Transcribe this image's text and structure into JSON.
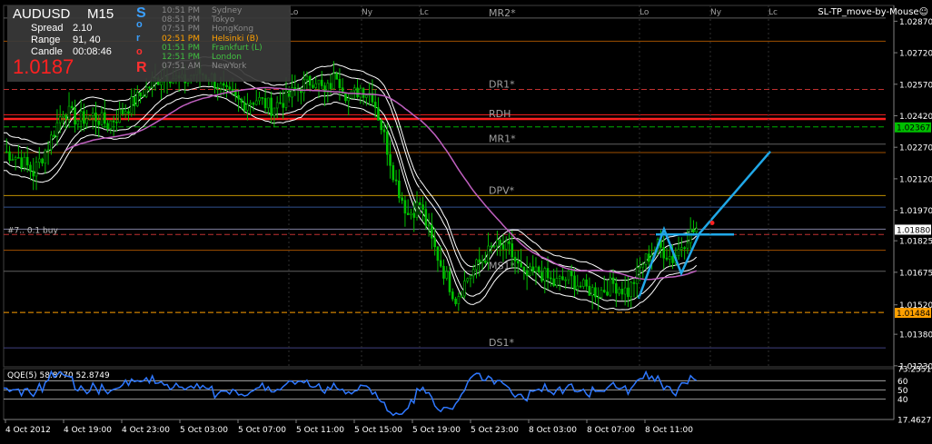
{
  "colors": {
    "background": "#000000",
    "candle_bull": "#00c000",
    "candle_bear": "#00c000",
    "envelope": "#ffffff",
    "ma": "#c060c0",
    "zigzag": "#20a8e8",
    "qqe_line": "#2f78ff",
    "grid": "#555555",
    "text": "#ffffff",
    "price_label_bg": "#ffffff",
    "green_level": "#00c000",
    "orange_level": "#ffa000",
    "red_level": "#ff2020"
  },
  "info": {
    "symbol": "AUDUSD",
    "timeframe": "M15",
    "spread_label": "Spread",
    "spread_value": "2.10",
    "range_label": "Range",
    "range_value": "91, 40",
    "candle_label": "Candle",
    "candle_value": "00:08:46",
    "price": "1.0187"
  },
  "vertical_letters": [
    {
      "ch": "S",
      "color": "#3aa0ff"
    },
    {
      "ch": "o",
      "color": "#3aa0ff"
    },
    {
      "ch": "r",
      "color": "#3aa0ff"
    },
    {
      "ch": "o",
      "color": "#ff3030"
    },
    {
      "ch": "R",
      "color": "#ff3030"
    }
  ],
  "sessions": [
    {
      "time": "10:51 PM",
      "city": "Sydney",
      "color": "#888888"
    },
    {
      "time": "08:51 PM",
      "city": "Tokyo",
      "color": "#888888"
    },
    {
      "time": "07:51 PM",
      "city": "HongKong",
      "color": "#888888"
    },
    {
      "time": "02:51 PM",
      "city": "Helsinki  (B)",
      "color": "#ffa000"
    },
    {
      "time": "01:51 PM",
      "city": "Frankfurt  (L)",
      "color": "#40c040"
    },
    {
      "time": "12:51 PM",
      "city": "London",
      "color": "#40c040"
    },
    {
      "time": "07:51 AM",
      "city": "NewYork",
      "color": "#888888"
    }
  ],
  "ea_label": "SL-TP_move-by-Mouse☺",
  "session_markers": [
    {
      "label": "Lo",
      "x": 318
    },
    {
      "label": "Ny",
      "x": 398
    },
    {
      "label": "Lc",
      "x": 462
    },
    {
      "label": "Lo",
      "x": 704
    },
    {
      "label": "Ny",
      "x": 782
    },
    {
      "label": "Lc",
      "x": 846
    }
  ],
  "chart_data": [
    {
      "type": "candlestick",
      "title": "AUDUSD M15",
      "ylim": [
        1.01225,
        1.02945
      ],
      "y_ticks": [
        "1.02870",
        "1.02720",
        "1.02570",
        "1.02420",
        "1.02270",
        "1.02120",
        "1.01970",
        "1.01825",
        "1.01675",
        "1.01520",
        "1.01380",
        "1.01230"
      ],
      "x_tick_labels": [
        "4 Oct 2012",
        "4 Oct 19:00",
        "4 Oct 23:00",
        "5 Oct 03:00",
        "5 Oct 07:00",
        "5 Oct 11:00",
        "5 Oct 15:00",
        "5 Oct 19:00",
        "5 Oct 23:00",
        "8 Oct 03:00",
        "8 Oct 07:00",
        "8 Oct 11:00"
      ],
      "price_close_path": [
        [
          0,
          1.0225
        ],
        [
          5,
          1.0222
        ],
        [
          10,
          1.0215
        ],
        [
          15,
          1.0228
        ],
        [
          20,
          1.0245
        ],
        [
          25,
          1.024
        ],
        [
          30,
          1.0242
        ],
        [
          35,
          1.0238
        ],
        [
          40,
          1.0244
        ],
        [
          45,
          1.025
        ],
        [
          50,
          1.0258
        ],
        [
          55,
          1.0262
        ],
        [
          60,
          1.0258
        ],
        [
          65,
          1.0263
        ],
        [
          70,
          1.026
        ],
        [
          75,
          1.0252
        ],
        [
          80,
          1.0248
        ],
        [
          85,
          1.025
        ],
        [
          90,
          1.0246
        ],
        [
          95,
          1.025
        ],
        [
          100,
          1.0256
        ],
        [
          105,
          1.026
        ],
        [
          108,
          1.0252
        ],
        [
          112,
          1.0262
        ],
        [
          116,
          1.025
        ],
        [
          120,
          1.0255
        ],
        [
          124,
          1.0252
        ],
        [
          128,
          1.0232
        ],
        [
          132,
          1.021
        ],
        [
          136,
          1.0195
        ],
        [
          140,
          1.02
        ],
        [
          144,
          1.0182
        ],
        [
          148,
          1.0168
        ],
        [
          152,
          1.0155
        ],
        [
          156,
          1.0165
        ],
        [
          160,
          1.0172
        ],
        [
          165,
          1.018
        ],
        [
          170,
          1.0178
        ],
        [
          175,
          1.0165
        ],
        [
          180,
          1.0168
        ],
        [
          185,
          1.0162
        ],
        [
          190,
          1.0165
        ],
        [
          195,
          1.016
        ],
        [
          200,
          1.0158
        ],
        [
          205,
          1.0162
        ],
        [
          210,
          1.0158
        ],
        [
          215,
          1.0172
        ],
        [
          220,
          1.018
        ],
        [
          225,
          1.0174
        ],
        [
          230,
          1.0185
        ],
        [
          233,
          1.0188
        ]
      ],
      "levels": [
        {
          "label": "MR2*",
          "price": 1.02885,
          "color": "#606060"
        },
        {
          "label": "",
          "price": 1.02775,
          "color": "#a05000"
        },
        {
          "label": "DR1*",
          "price": 1.02545,
          "color": "#c03030"
        },
        {
          "label": "",
          "price": 1.02425,
          "color": "#ff2020"
        },
        {
          "label": "RDH",
          "price": 1.02405,
          "color": "#ff2020"
        },
        {
          "label": "",
          "price": 1.02367,
          "color": "#00b000"
        },
        {
          "label": "MR1*",
          "price": 1.02285,
          "color": "#606060"
        },
        {
          "label": "",
          "price": 1.02245,
          "color": "#a05000"
        },
        {
          "label": "DPV*",
          "price": 1.0204,
          "color": "#c09000"
        },
        {
          "label": "",
          "price": 1.01985,
          "color": "#305090"
        },
        {
          "label": "",
          "price": 1.0188,
          "color": "#8080a0"
        },
        {
          "label": "",
          "price": 1.01855,
          "color": "#c03030"
        },
        {
          "label": "",
          "price": 1.0178,
          "color": "#a05000"
        },
        {
          "label": "MS1*",
          "price": 1.0168,
          "color": "#606060"
        },
        {
          "label": "",
          "price": 1.01484,
          "color": "#ffa000"
        },
        {
          "label": "DS1*",
          "price": 1.01315,
          "color": "#404080"
        }
      ],
      "price_labels": [
        {
          "value": "1.02367",
          "price": 1.02367,
          "bg": "#00c000",
          "fg": "#000000"
        },
        {
          "value": "1.01880",
          "price": 1.0188,
          "bg": "#ffffff",
          "fg": "#000000"
        },
        {
          "value": "1.01484",
          "price": 1.01484,
          "bg": "#ffa000",
          "fg": "#000000"
        }
      ],
      "order_label": "#7.. 0.1 buy"
    },
    {
      "type": "line",
      "title": "QQE(5) 58.8770 52.8749",
      "ylim": [
        17.4627,
        73.2551
      ],
      "y_ticks": [
        "73.2551",
        "60",
        "50",
        "40",
        "17.4627"
      ],
      "levels": [
        60,
        50,
        40
      ]
    }
  ]
}
